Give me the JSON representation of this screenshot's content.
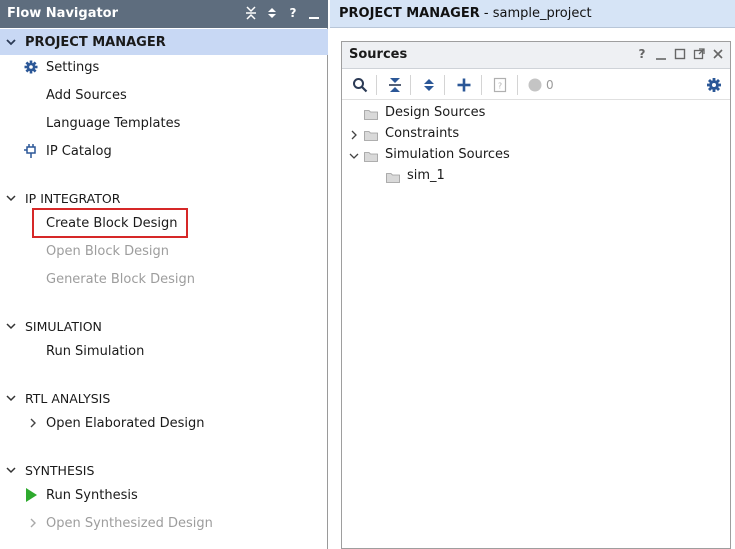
{
  "flow_navigator": {
    "title": "Flow Navigator",
    "header_icons": [
      "collapse-all-icon",
      "expand-all-icon",
      "help-icon",
      "minimize-icon"
    ],
    "project_manager": {
      "label": "PROJECT MANAGER",
      "items": {
        "settings": "Settings",
        "add_sources": "Add Sources",
        "language_templates": "Language Templates",
        "ip_catalog": "IP Catalog"
      }
    },
    "ip_integrator": {
      "label": "IP INTEGRATOR",
      "items": {
        "create_block_design": "Create Block Design",
        "open_block_design": "Open Block Design",
        "generate_block_design": "Generate Block Design"
      }
    },
    "simulation": {
      "label": "SIMULATION",
      "items": {
        "run_simulation": "Run Simulation"
      }
    },
    "rtl_analysis": {
      "label": "RTL ANALYSIS",
      "items": {
        "open_elaborated_design": "Open Elaborated Design"
      }
    },
    "synthesis": {
      "label": "SYNTHESIS",
      "items": {
        "run_synthesis": "Run Synthesis",
        "open_synthesized_design": "Open Synthesized Design"
      }
    },
    "highlight_color": "#d62828",
    "selected_bg": "#c8d8f4"
  },
  "project_manager_header": {
    "title": "PROJECT MANAGER",
    "project": " - sample_project"
  },
  "sources": {
    "title": "Sources",
    "header_icons": [
      "help-icon",
      "minimize-icon",
      "maximize-icon",
      "float-icon",
      "close-icon"
    ],
    "toolbar": {
      "icons": [
        "search-icon",
        "collapse-all-icon",
        "expand-all-icon",
        "add-icon",
        "properties-icon",
        "status-dot-icon",
        "gear-icon"
      ],
      "count": "0"
    },
    "tree": {
      "design_sources": "Design Sources",
      "constraints": "Constraints",
      "simulation_sources": "Simulation Sources",
      "sim_1": "sim_1"
    }
  },
  "colors": {
    "nav_header": "#5e6d7e",
    "accent_blue": "#2b5797",
    "run_green": "#2eaa2e"
  }
}
